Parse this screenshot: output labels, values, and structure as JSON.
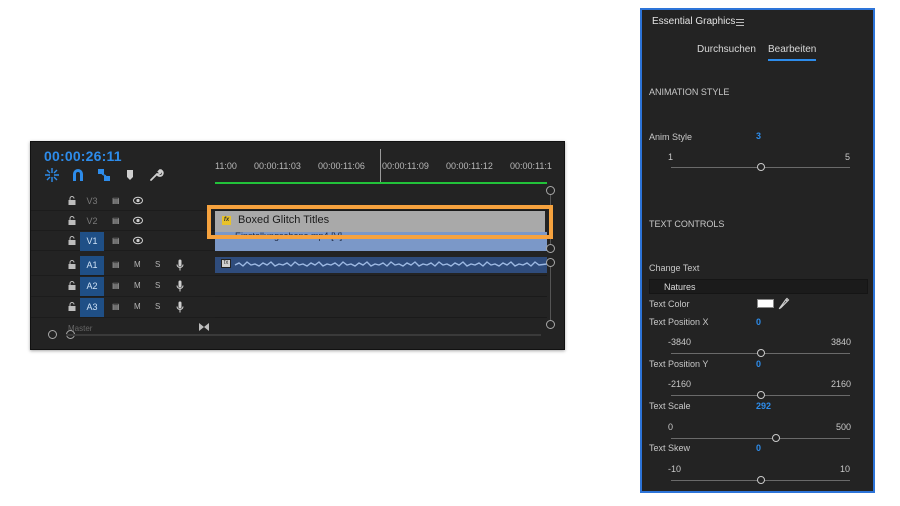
{
  "timeline": {
    "timecode": "00:00:26:11",
    "ruler_labels": [
      "11:00",
      "00:00:11:03",
      "00:00:11:06",
      "00:00:11:09",
      "00:00:11:12",
      "00:00:11:1"
    ],
    "tracks": [
      {
        "name": "V3",
        "kind": "video",
        "active": false
      },
      {
        "name": "V2",
        "kind": "video",
        "active": false
      },
      {
        "name": "V1",
        "kind": "video",
        "active": true
      },
      {
        "name": "A1",
        "kind": "audio",
        "active": true
      },
      {
        "name": "A2",
        "kind": "audio",
        "active": true
      },
      {
        "name": "A3",
        "kind": "audio",
        "active": true
      }
    ],
    "audio_toggles": {
      "mute": "M",
      "solo": "S"
    },
    "graphics_clip": "Boxed Glitch Titles",
    "v1_clip": "Einstellungsebene.mp4 [V]",
    "bottom_faded_label": "Master",
    "colors": {
      "timecode": "#2d8ceb",
      "highlight": "#f6a23e",
      "work_area": "#22c23a"
    }
  },
  "essential_graphics": {
    "title": "Essential Graphics",
    "tabs": [
      {
        "label": "Durchsuchen",
        "active": false
      },
      {
        "label": "Bearbeiten",
        "active": true
      }
    ],
    "animation_section": "ANIMATION STYLE",
    "anim_style": {
      "label": "Anim Style",
      "value": "3",
      "min": "1",
      "max": "5",
      "position": 0.5
    },
    "text_section": "TEXT CONTROLS",
    "change_text": {
      "label": "Change Text",
      "value": "Natures"
    },
    "text_color": {
      "label": "Text Color",
      "color": "#ffffff"
    },
    "text_position_x": {
      "label": "Text Position X",
      "value": "0",
      "min": "-3840",
      "max": "3840",
      "position": 0.5
    },
    "text_position_y": {
      "label": "Text Position Y",
      "value": "0",
      "min": "-2160",
      "max": "2160",
      "position": 0.5
    },
    "text_scale": {
      "label": "Text Scale",
      "value": "292",
      "min": "0",
      "max": "500",
      "position": 0.584
    },
    "text_skew": {
      "label": "Text Skew",
      "value": "0",
      "min": "-10",
      "max": "10",
      "position": 0.5
    },
    "colors": {
      "accent": "#2d8ceb",
      "panel_border": "#2d74d8"
    }
  }
}
